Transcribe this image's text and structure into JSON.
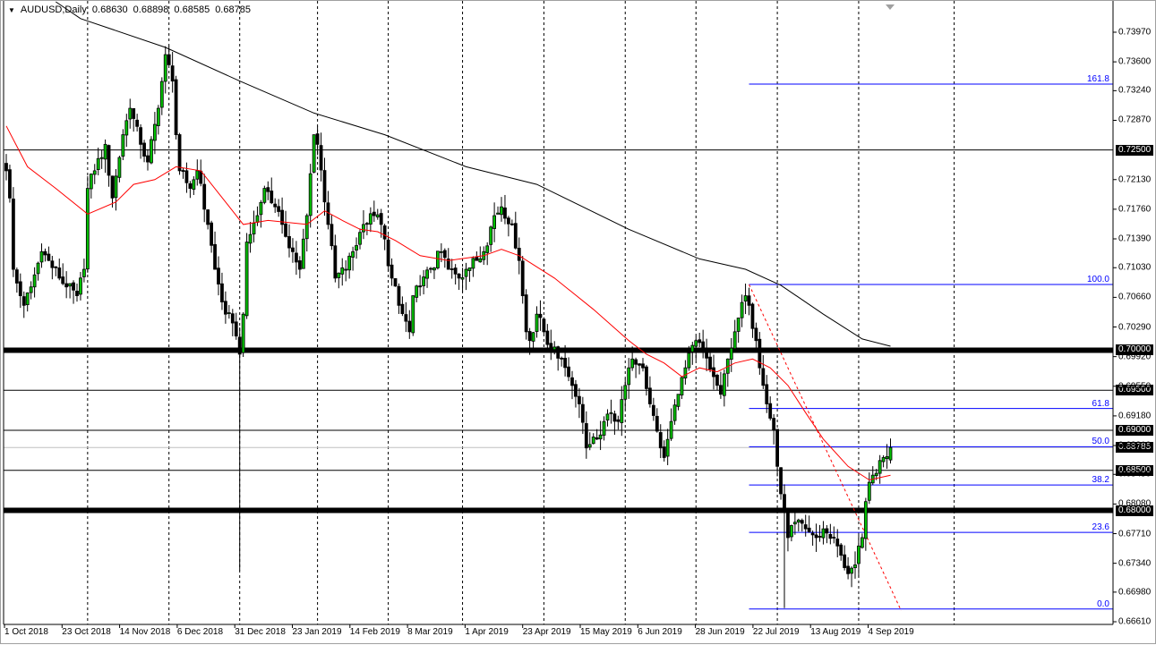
{
  "header": {
    "symbol": "AUDUSD,Daily",
    "open": "0.68630",
    "high": "0.68898",
    "low": "0.68585",
    "close": "0.68785"
  },
  "chart_data": {
    "type": "candlestick",
    "title": "AUDUSD,Daily",
    "ylim": [
      0.6661,
      0.7397
    ],
    "y_ticks": [
      "0.73970",
      "0.73600",
      "0.73240",
      "0.72870",
      "0.72130",
      "0.71760",
      "0.71390",
      "0.71030",
      "0.70660",
      "0.70290",
      "0.69920",
      "0.69550",
      "0.69180",
      "0.68810",
      "0.68450",
      "0.68080",
      "0.67710",
      "0.67340",
      "0.66980",
      "0.66610"
    ],
    "x_labels": [
      "1 Oct 2018",
      "23 Oct 2018",
      "14 Nov 2018",
      "6 Dec 2018",
      "31 Dec 2018",
      "23 Jan 2019",
      "14 Feb 2019",
      "8 Mar 2019",
      "1 Apr 2019",
      "23 Apr 2019",
      "15 May 2019",
      "6 Jun 2019",
      "28 Jun 2019",
      "22 Jul 2019",
      "13 Aug 2019",
      "4 Sep 2019"
    ],
    "bar_count": 251,
    "close_anchors": [
      [
        0,
        0.7224
      ],
      [
        1,
        0.719
      ],
      [
        2,
        0.7101
      ],
      [
        4,
        0.7068
      ],
      [
        5,
        0.7056
      ],
      [
        7,
        0.7079
      ],
      [
        10,
        0.7123
      ],
      [
        12,
        0.7112
      ],
      [
        15,
        0.709
      ],
      [
        17,
        0.7079
      ],
      [
        20,
        0.7068
      ],
      [
        22,
        0.7101
      ],
      [
        23,
        0.7202
      ],
      [
        25,
        0.7224
      ],
      [
        28,
        0.7257
      ],
      [
        30,
        0.719
      ],
      [
        33,
        0.7269
      ],
      [
        35,
        0.7302
      ],
      [
        38,
        0.7257
      ],
      [
        40,
        0.7235
      ],
      [
        43,
        0.7302
      ],
      [
        45,
        0.7369
      ],
      [
        47,
        0.7336
      ],
      [
        48,
        0.7269
      ],
      [
        49,
        0.7224
      ],
      [
        52,
        0.7202
      ],
      [
        54,
        0.7224
      ],
      [
        57,
        0.7157
      ],
      [
        59,
        0.7101
      ],
      [
        62,
        0.7045
      ],
      [
        64,
        0.7034
      ],
      [
        66,
        0.6995
      ],
      [
        67,
        0.7045
      ],
      [
        68,
        0.7135
      ],
      [
        71,
        0.7168
      ],
      [
        73,
        0.7202
      ],
      [
        76,
        0.7179
      ],
      [
        78,
        0.7157
      ],
      [
        81,
        0.7123
      ],
      [
        83,
        0.7101
      ],
      [
        85,
        0.7168
      ],
      [
        87,
        0.7269
      ],
      [
        88,
        0.7257
      ],
      [
        91,
        0.7157
      ],
      [
        93,
        0.709
      ],
      [
        96,
        0.7101
      ],
      [
        98,
        0.7123
      ],
      [
        101,
        0.7157
      ],
      [
        104,
        0.7168
      ],
      [
        106,
        0.7157
      ],
      [
        109,
        0.709
      ],
      [
        111,
        0.7056
      ],
      [
        114,
        0.7023
      ],
      [
        115,
        0.7068
      ],
      [
        117,
        0.7079
      ],
      [
        120,
        0.7101
      ],
      [
        123,
        0.7123
      ],
      [
        125,
        0.7101
      ],
      [
        128,
        0.709
      ],
      [
        130,
        0.7101
      ],
      [
        133,
        0.7112
      ],
      [
        135,
        0.7123
      ],
      [
        138,
        0.7168
      ],
      [
        140,
        0.7179
      ],
      [
        143,
        0.7157
      ],
      [
        145,
        0.7112
      ],
      [
        147,
        0.7023
      ],
      [
        148,
        0.7012
      ],
      [
        150,
        0.7045
      ],
      [
        152,
        0.7023
      ],
      [
        154,
        0.7
      ],
      [
        157,
        0.6989
      ],
      [
        159,
        0.6967
      ],
      [
        162,
        0.6933
      ],
      [
        164,
        0.6878
      ],
      [
        167,
        0.6889
      ],
      [
        169,
        0.6911
      ],
      [
        171,
        0.6922
      ],
      [
        173,
        0.6911
      ],
      [
        175,
        0.6956
      ],
      [
        177,
        0.6989
      ],
      [
        180,
        0.6978
      ],
      [
        182,
        0.6933
      ],
      [
        185,
        0.6878
      ],
      [
        186,
        0.6866
      ],
      [
        188,
        0.6911
      ],
      [
        190,
        0.6945
      ],
      [
        192,
        0.6978
      ],
      [
        195,
        0.7012
      ],
      [
        197,
        0.7
      ],
      [
        200,
        0.6967
      ],
      [
        202,
        0.6945
      ],
      [
        204,
        0.6989
      ],
      [
        206,
        0.7023
      ],
      [
        209,
        0.7068
      ],
      [
        210,
        0.7056
      ],
      [
        212,
        0.7012
      ],
      [
        213,
        0.6978
      ],
      [
        215,
        0.6933
      ],
      [
        217,
        0.69
      ],
      [
        218,
        0.6855
      ],
      [
        220,
        0.6799
      ],
      [
        221,
        0.6766
      ],
      [
        224,
        0.6788
      ],
      [
        226,
        0.6777
      ],
      [
        229,
        0.6766
      ],
      [
        231,
        0.6777
      ],
      [
        234,
        0.6766
      ],
      [
        236,
        0.6744
      ],
      [
        238,
        0.6721
      ],
      [
        240,
        0.6732
      ],
      [
        242,
        0.6766
      ],
      [
        243,
        0.6811
      ],
      [
        245,
        0.6844
      ],
      [
        248,
        0.6866
      ],
      [
        250,
        0.68785
      ]
    ],
    "last_bar": {
      "open": 0.6863,
      "high": 0.68898,
      "low": 0.68585,
      "close": 0.68785
    },
    "ma_slow": [
      [
        14,
        0.7435
      ],
      [
        21,
        0.7414
      ],
      [
        45,
        0.7378
      ],
      [
        66,
        0.7336
      ],
      [
        87,
        0.7296
      ],
      [
        107,
        0.7269
      ],
      [
        130,
        0.7229
      ],
      [
        150,
        0.7207
      ],
      [
        176,
        0.7151
      ],
      [
        196,
        0.7114
      ],
      [
        209,
        0.7101
      ],
      [
        219,
        0.7081
      ],
      [
        231,
        0.7045
      ],
      [
        242,
        0.7014
      ],
      [
        250,
        0.7005
      ]
    ],
    "ma_fast": [
      [
        0,
        0.728
      ],
      [
        6,
        0.7229
      ],
      [
        14,
        0.7202
      ],
      [
        23,
        0.717
      ],
      [
        31,
        0.7185
      ],
      [
        36,
        0.7207
      ],
      [
        42,
        0.7213
      ],
      [
        48,
        0.7229
      ],
      [
        55,
        0.7224
      ],
      [
        62,
        0.7185
      ],
      [
        67,
        0.7157
      ],
      [
        74,
        0.7162
      ],
      [
        85,
        0.7157
      ],
      [
        90,
        0.7174
      ],
      [
        95,
        0.7162
      ],
      [
        100,
        0.7151
      ],
      [
        105,
        0.7148
      ],
      [
        110,
        0.7137
      ],
      [
        117,
        0.7118
      ],
      [
        125,
        0.7112
      ],
      [
        135,
        0.7118
      ],
      [
        140,
        0.7126
      ],
      [
        145,
        0.7118
      ],
      [
        155,
        0.709
      ],
      [
        166,
        0.7051
      ],
      [
        176,
        0.7012
      ],
      [
        181,
        0.6995
      ],
      [
        186,
        0.6984
      ],
      [
        191,
        0.6967
      ],
      [
        196,
        0.6978
      ],
      [
        201,
        0.6973
      ],
      [
        206,
        0.6984
      ],
      [
        211,
        0.6989
      ],
      [
        216,
        0.6978
      ],
      [
        221,
        0.6956
      ],
      [
        226,
        0.6922
      ],
      [
        231,
        0.6889
      ],
      [
        238,
        0.6855
      ],
      [
        244,
        0.6838
      ],
      [
        250,
        0.6844
      ]
    ],
    "grid_bars": [
      23,
      46,
      66,
      88,
      108,
      129,
      152,
      175,
      195,
      218,
      241,
      268
    ],
    "horizontal_levels": [
      {
        "price": 0.725,
        "label": "0.72500",
        "weight": "thin"
      },
      {
        "price": 0.7,
        "label": "0.70000",
        "weight": "thick"
      },
      {
        "price": 0.695,
        "label": "0.69500",
        "weight": "thin"
      },
      {
        "price": 0.69,
        "label": "0.69000",
        "weight": "thin"
      },
      {
        "price": 0.685,
        "label": "0.68500",
        "weight": "thin"
      },
      {
        "price": 0.68,
        "label": "0.68000",
        "weight": "thick"
      }
    ],
    "current_price": {
      "price": 0.68785,
      "label": "0.68785"
    },
    "fibonacci": {
      "from_bar": 210,
      "high": 0.7082,
      "low": 0.6677,
      "levels": [
        {
          "ratio": 1.618,
          "label": "161.8"
        },
        {
          "ratio": 1.0,
          "label": "100.0"
        },
        {
          "ratio": 0.618,
          "label": "61.8"
        },
        {
          "ratio": 0.5,
          "label": "50.0"
        },
        {
          "ratio": 0.382,
          "label": "38.2"
        },
        {
          "ratio": 0.236,
          "label": "23.6"
        },
        {
          "ratio": 0.0,
          "label": "0.0"
        }
      ]
    },
    "trendline": {
      "from": [
        210,
        0.7082
      ],
      "to": [
        253,
        0.6675
      ]
    },
    "colors": {
      "bull": "#00c000",
      "bear": "#000000",
      "ma_fast": "#ff0000",
      "ma_slow": "#000000",
      "fib": "#0000ff",
      "trend": "#ff0000"
    }
  }
}
